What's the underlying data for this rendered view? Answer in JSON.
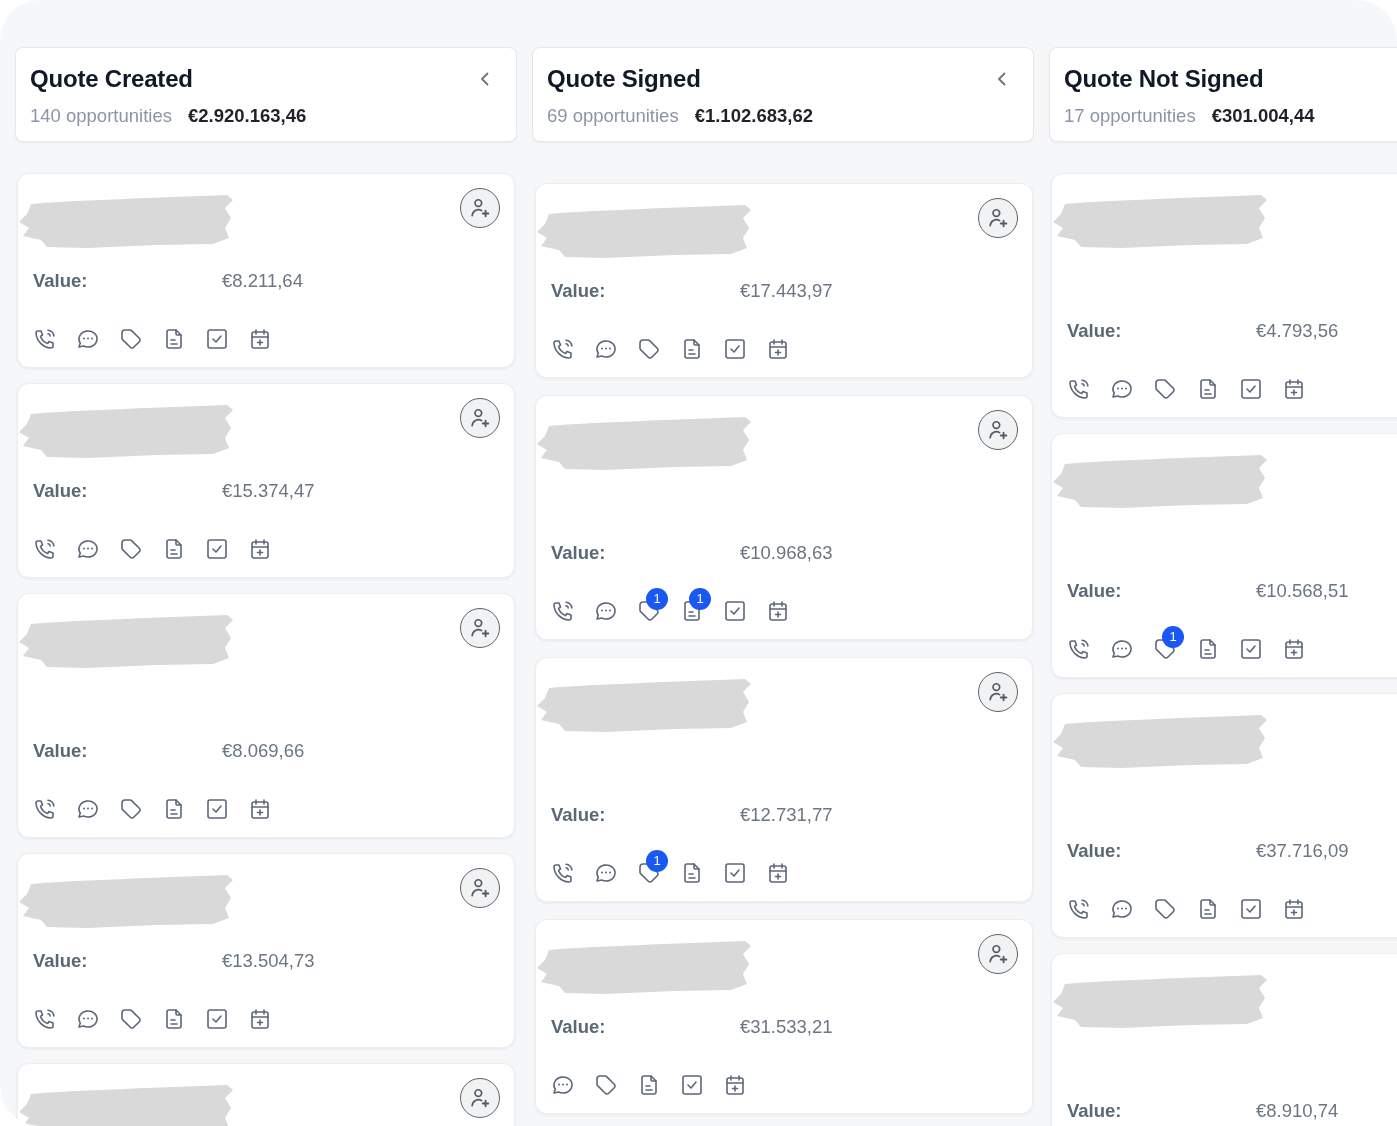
{
  "columns": [
    {
      "title": "Quote Created",
      "count": "140 opportunities",
      "total": "€2.920.163,46",
      "cards": [
        {
          "kind": "short",
          "value_label": "Value:",
          "value": "€8.211,64",
          "actions": [
            {
              "kind": "phone"
            },
            {
              "kind": "message"
            },
            {
              "kind": "tag"
            },
            {
              "kind": "document"
            },
            {
              "kind": "task"
            },
            {
              "kind": "event"
            }
          ]
        },
        {
          "kind": "short",
          "value_label": "Value:",
          "value": "€15.374,47",
          "actions": [
            {
              "kind": "phone"
            },
            {
              "kind": "message"
            },
            {
              "kind": "tag"
            },
            {
              "kind": "document"
            },
            {
              "kind": "task"
            },
            {
              "kind": "event"
            }
          ]
        },
        {
          "kind": "tall",
          "value_label": "Value:",
          "value": "€8.069,66",
          "actions": [
            {
              "kind": "phone"
            },
            {
              "kind": "message"
            },
            {
              "kind": "tag"
            },
            {
              "kind": "document"
            },
            {
              "kind": "task"
            },
            {
              "kind": "event"
            }
          ]
        },
        {
          "kind": "short",
          "value_label": "Value:",
          "value": "€13.504,73",
          "actions": [
            {
              "kind": "phone"
            },
            {
              "kind": "message"
            },
            {
              "kind": "tag"
            },
            {
              "kind": "document"
            },
            {
              "kind": "task"
            },
            {
              "kind": "event"
            }
          ]
        },
        {
          "kind": "short"
        }
      ]
    },
    {
      "title": "Quote Signed",
      "count": "69 opportunities",
      "total": "€1.102.683,62",
      "cards": [
        {
          "kind": "short",
          "value_label": "Value:",
          "value": "€17.443,97",
          "actions": [
            {
              "kind": "phone"
            },
            {
              "kind": "message"
            },
            {
              "kind": "tag"
            },
            {
              "kind": "document"
            },
            {
              "kind": "task"
            },
            {
              "kind": "event"
            }
          ]
        },
        {
          "kind": "tall",
          "value_label": "Value:",
          "value": "€10.968,63",
          "actions": [
            {
              "kind": "phone"
            },
            {
              "kind": "message"
            },
            {
              "kind": "tag",
              "badge": "1"
            },
            {
              "kind": "document",
              "badge": "1"
            },
            {
              "kind": "task"
            },
            {
              "kind": "event"
            }
          ]
        },
        {
          "kind": "tall",
          "value_label": "Value:",
          "value": "€12.731,77",
          "actions": [
            {
              "kind": "phone"
            },
            {
              "kind": "message"
            },
            {
              "kind": "tag",
              "badge": "1"
            },
            {
              "kind": "document"
            },
            {
              "kind": "task"
            },
            {
              "kind": "event"
            }
          ]
        },
        {
          "kind": "short",
          "value_label": "Value:",
          "value": "€31.533,21",
          "actions": [
            {
              "kind": "message"
            },
            {
              "kind": "tag"
            },
            {
              "kind": "document"
            },
            {
              "kind": "task"
            },
            {
              "kind": "event"
            }
          ]
        }
      ]
    },
    {
      "title": "Quote Not Signed",
      "count": "17 opportunities",
      "total": "€301.004,44",
      "cards": [
        {
          "kind": "tall",
          "value_label": "Value:",
          "value": "€4.793,56",
          "actions": [
            {
              "kind": "phone"
            },
            {
              "kind": "message"
            },
            {
              "kind": "tag"
            },
            {
              "kind": "document"
            },
            {
              "kind": "task"
            },
            {
              "kind": "event"
            }
          ]
        },
        {
          "kind": "tall",
          "value_label": "Value:",
          "value": "€10.568,51",
          "actions": [
            {
              "kind": "phone"
            },
            {
              "kind": "message"
            },
            {
              "kind": "tag",
              "badge": "1"
            },
            {
              "kind": "document"
            },
            {
              "kind": "task"
            },
            {
              "kind": "event"
            }
          ]
        },
        {
          "kind": "tall",
          "value_label": "Value:",
          "value": "€37.716,09",
          "actions": [
            {
              "kind": "phone"
            },
            {
              "kind": "message"
            },
            {
              "kind": "tag"
            },
            {
              "kind": "document"
            },
            {
              "kind": "task"
            },
            {
              "kind": "event"
            }
          ]
        },
        {
          "kind": "tall",
          "value_label": "Value:",
          "value": "€8.910,74"
        }
      ]
    }
  ]
}
